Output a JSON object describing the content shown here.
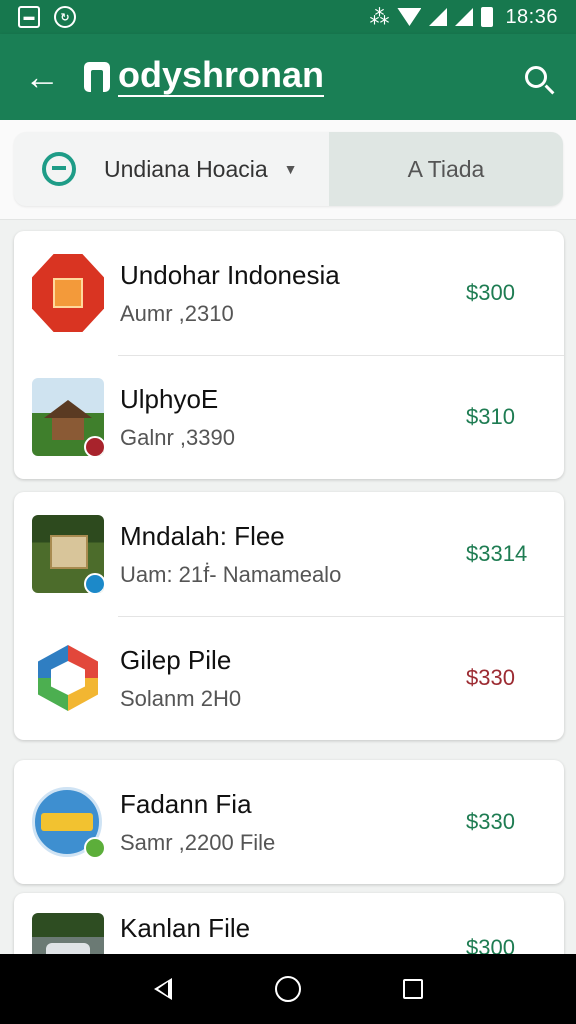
{
  "status_bar": {
    "time": "18:36",
    "icons": [
      "photo-notification-icon",
      "sync-notification-icon",
      "vibrate-icon",
      "wifi-icon",
      "signal-icon",
      "signal-icon",
      "battery-icon"
    ]
  },
  "app_bar": {
    "title": "odyshronan",
    "back_icon": "arrow-left-icon",
    "search_icon": "search-icon"
  },
  "filter": {
    "location_label": "Undiana Hoacia",
    "secondary_label": "A Tiada"
  },
  "items": [
    {
      "title": "Undohar Indonesia",
      "subtitle": "Aumr ,2310",
      "price": "$300",
      "thumb": "orange-badge-icon"
    },
    {
      "title": "UlphyoE",
      "subtitle": "Galnr ,3390",
      "price": "$310",
      "thumb": "hut-photo"
    },
    {
      "title": "Mndalah: Flee",
      "subtitle": "Uam: 21ḟ- Namamealo",
      "price": "$3314",
      "thumb": "box-photo"
    },
    {
      "title": "Gilep Pile",
      "subtitle": "Solanm 2H0",
      "price": "$330",
      "thumb": "hexagon-logo-icon"
    },
    {
      "title": "Fadann Fia",
      "subtitle": "Samr ,2200  File",
      "price": "$330",
      "thumb": "round-logo-icon"
    },
    {
      "title": "Kanlan File",
      "subtitle": "",
      "price": "$300",
      "thumb": "car-photo"
    }
  ],
  "colors": {
    "primary": "#1a7f55",
    "status_bar": "#17784e",
    "price_positive": "#1e7c52",
    "price_negative": "#9c2b32"
  }
}
